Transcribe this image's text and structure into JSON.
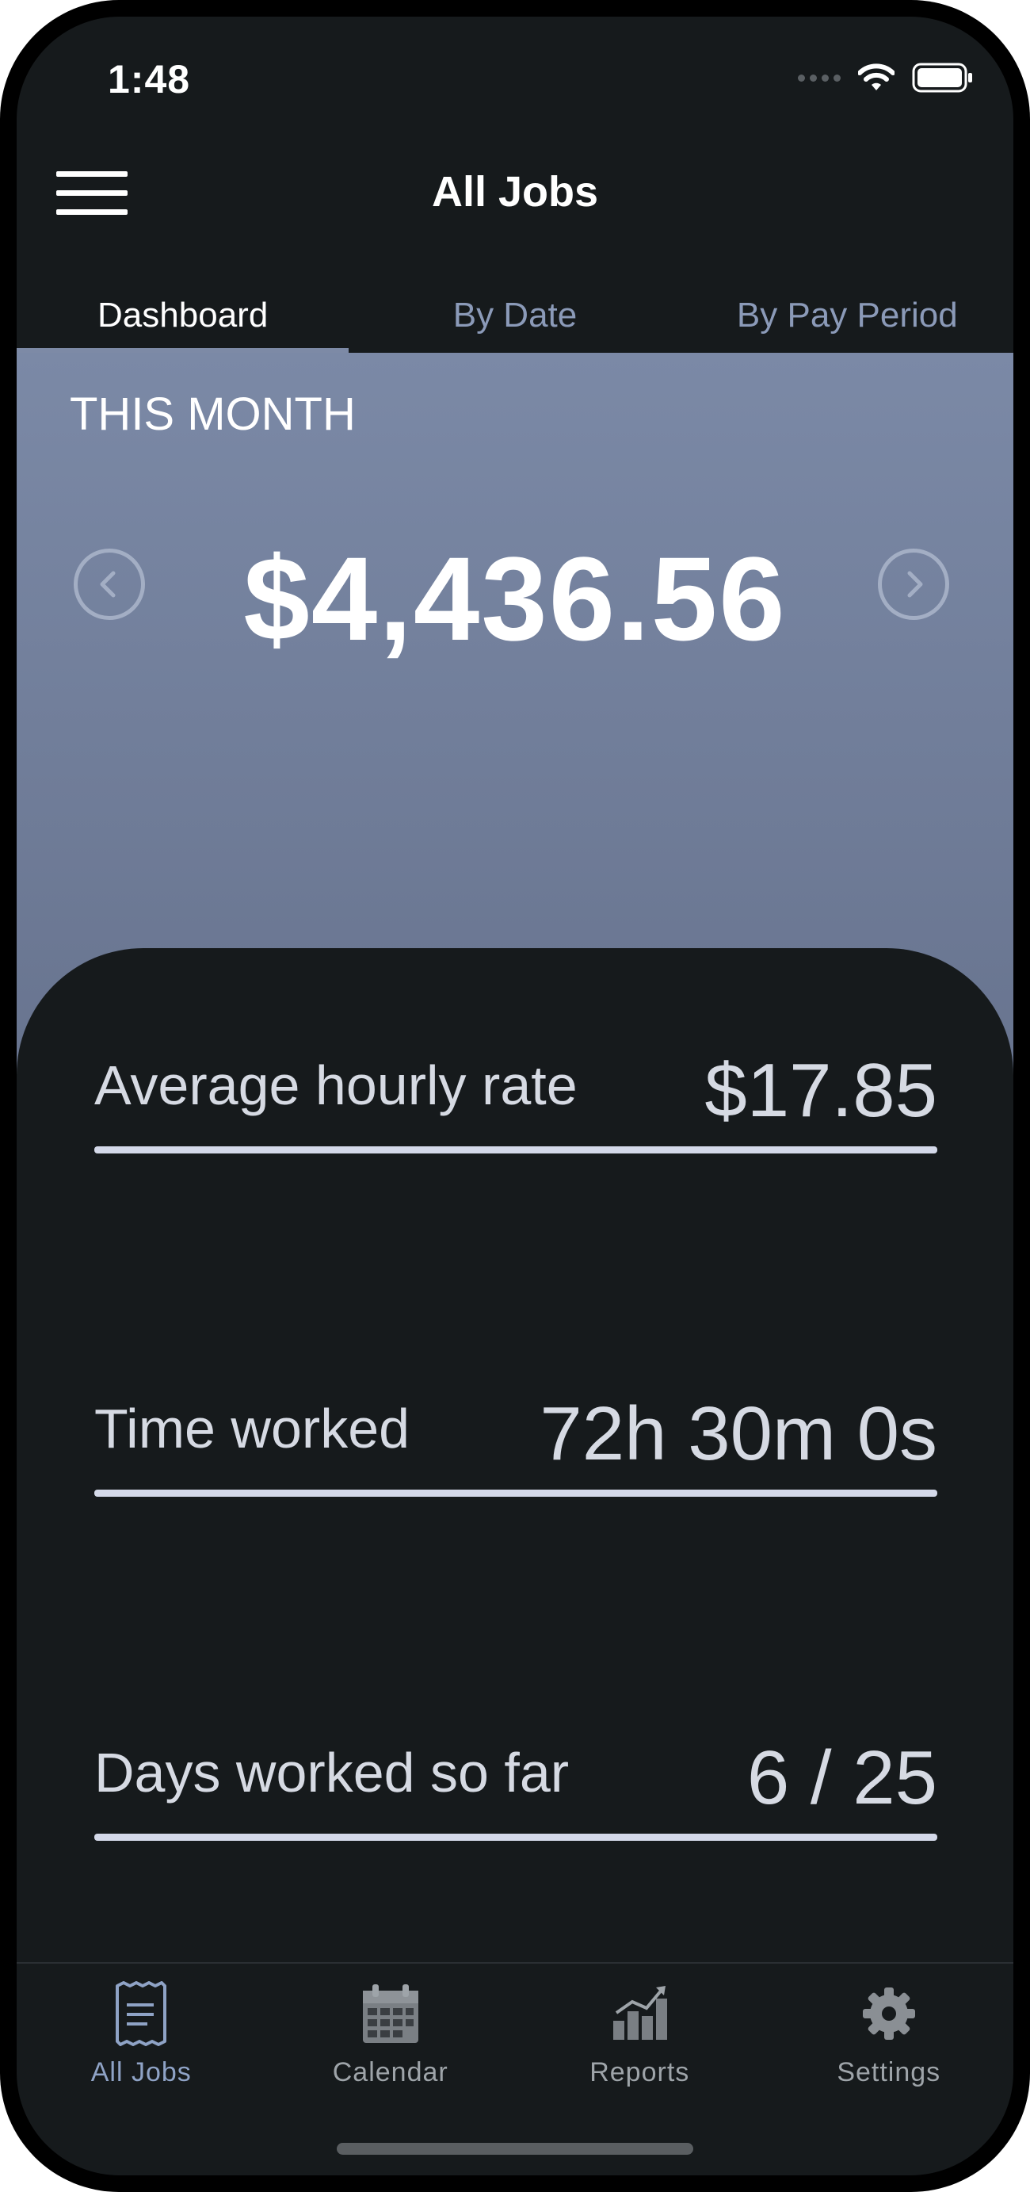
{
  "status_bar": {
    "time": "1:48"
  },
  "header": {
    "title": "All Jobs"
  },
  "tabs": [
    {
      "label": "Dashboard",
      "active": true
    },
    {
      "label": "By Date",
      "active": false
    },
    {
      "label": "By Pay Period",
      "active": false
    }
  ],
  "hero": {
    "period_label": "THIS MONTH",
    "amount": "$4,436.56"
  },
  "stats": [
    {
      "label": "Average hourly rate",
      "value": "$17.85"
    },
    {
      "label": "Time worked",
      "value": "72h 30m 0s"
    },
    {
      "label": "Days worked so far",
      "value": "6 / 25"
    }
  ],
  "tab_bar": [
    {
      "label": "All Jobs",
      "icon": "receipt-icon",
      "active": true
    },
    {
      "label": "Calendar",
      "icon": "calendar-icon",
      "active": false
    },
    {
      "label": "Reports",
      "icon": "chart-icon",
      "active": false
    },
    {
      "label": "Settings",
      "icon": "gear-icon",
      "active": false
    }
  ],
  "colors": {
    "background": "#161a1c",
    "hero_gradient_top": "#7b89a6",
    "hero_gradient_bottom": "#67738e",
    "accent": "#8fa3c6",
    "tab_inactive": "#8b9ab8"
  }
}
